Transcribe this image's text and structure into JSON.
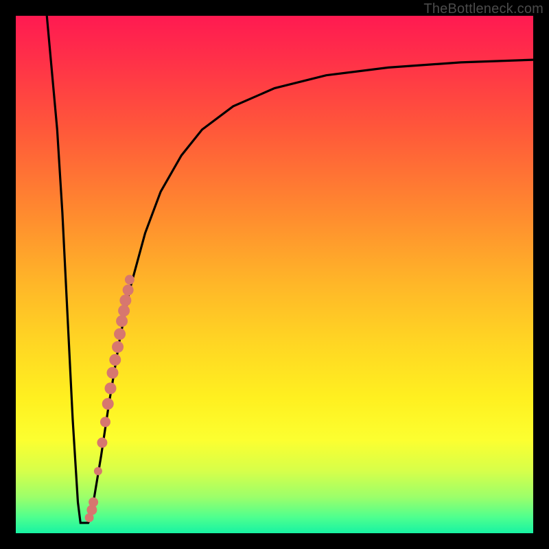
{
  "watermark": "TheBottleneck.com",
  "colors": {
    "curve": "#000000",
    "dot_fill": "#d7776f",
    "dot_stroke": "#bc5a54",
    "frame": "#000000"
  },
  "chart_data": {
    "type": "line",
    "title": "",
    "xlabel": "",
    "ylabel": "",
    "xlim": [
      0,
      100
    ],
    "ylim": [
      0,
      100
    ],
    "series": [
      {
        "name": "bottleneck-curve",
        "x": [
          6.0,
          8.0,
          9.0,
          10.0,
          11.0,
          12.0,
          12.5,
          13.0,
          14.0,
          14.5,
          15.0,
          16.5,
          18.0,
          20.0,
          22.0,
          25.0,
          28.0,
          32.0,
          36.0,
          42.0,
          50.0,
          60.0,
          72.0,
          86.0,
          100.0
        ],
        "y": [
          100.0,
          78.0,
          62.0,
          42.0,
          22.0,
          6.0,
          2.0,
          2.0,
          2.0,
          3.0,
          6.0,
          15.0,
          25.0,
          37.0,
          47.0,
          58.0,
          66.0,
          73.0,
          78.0,
          82.5,
          86.0,
          88.5,
          90.0,
          91.0,
          91.5
        ]
      }
    ],
    "points": {
      "name": "highlighted-dots",
      "x": [
        14.2,
        14.7,
        15.0,
        15.9,
        16.7,
        17.3,
        17.8,
        18.3,
        18.7,
        19.2,
        19.7,
        20.1,
        20.5,
        20.9,
        21.2,
        21.7,
        22.0
      ],
      "y": [
        3.0,
        4.5,
        6.0,
        12.0,
        17.5,
        21.5,
        25.0,
        28.0,
        31.0,
        33.5,
        36.0,
        38.5,
        41.0,
        43.0,
        45.0,
        47.0,
        49.0
      ],
      "r": [
        6.5,
        7.5,
        7.0,
        6.0,
        7.5,
        7.5,
        8.5,
        8.5,
        8.5,
        8.5,
        8.5,
        8.5,
        8.5,
        8.5,
        8.5,
        8.0,
        7.0
      ]
    }
  }
}
